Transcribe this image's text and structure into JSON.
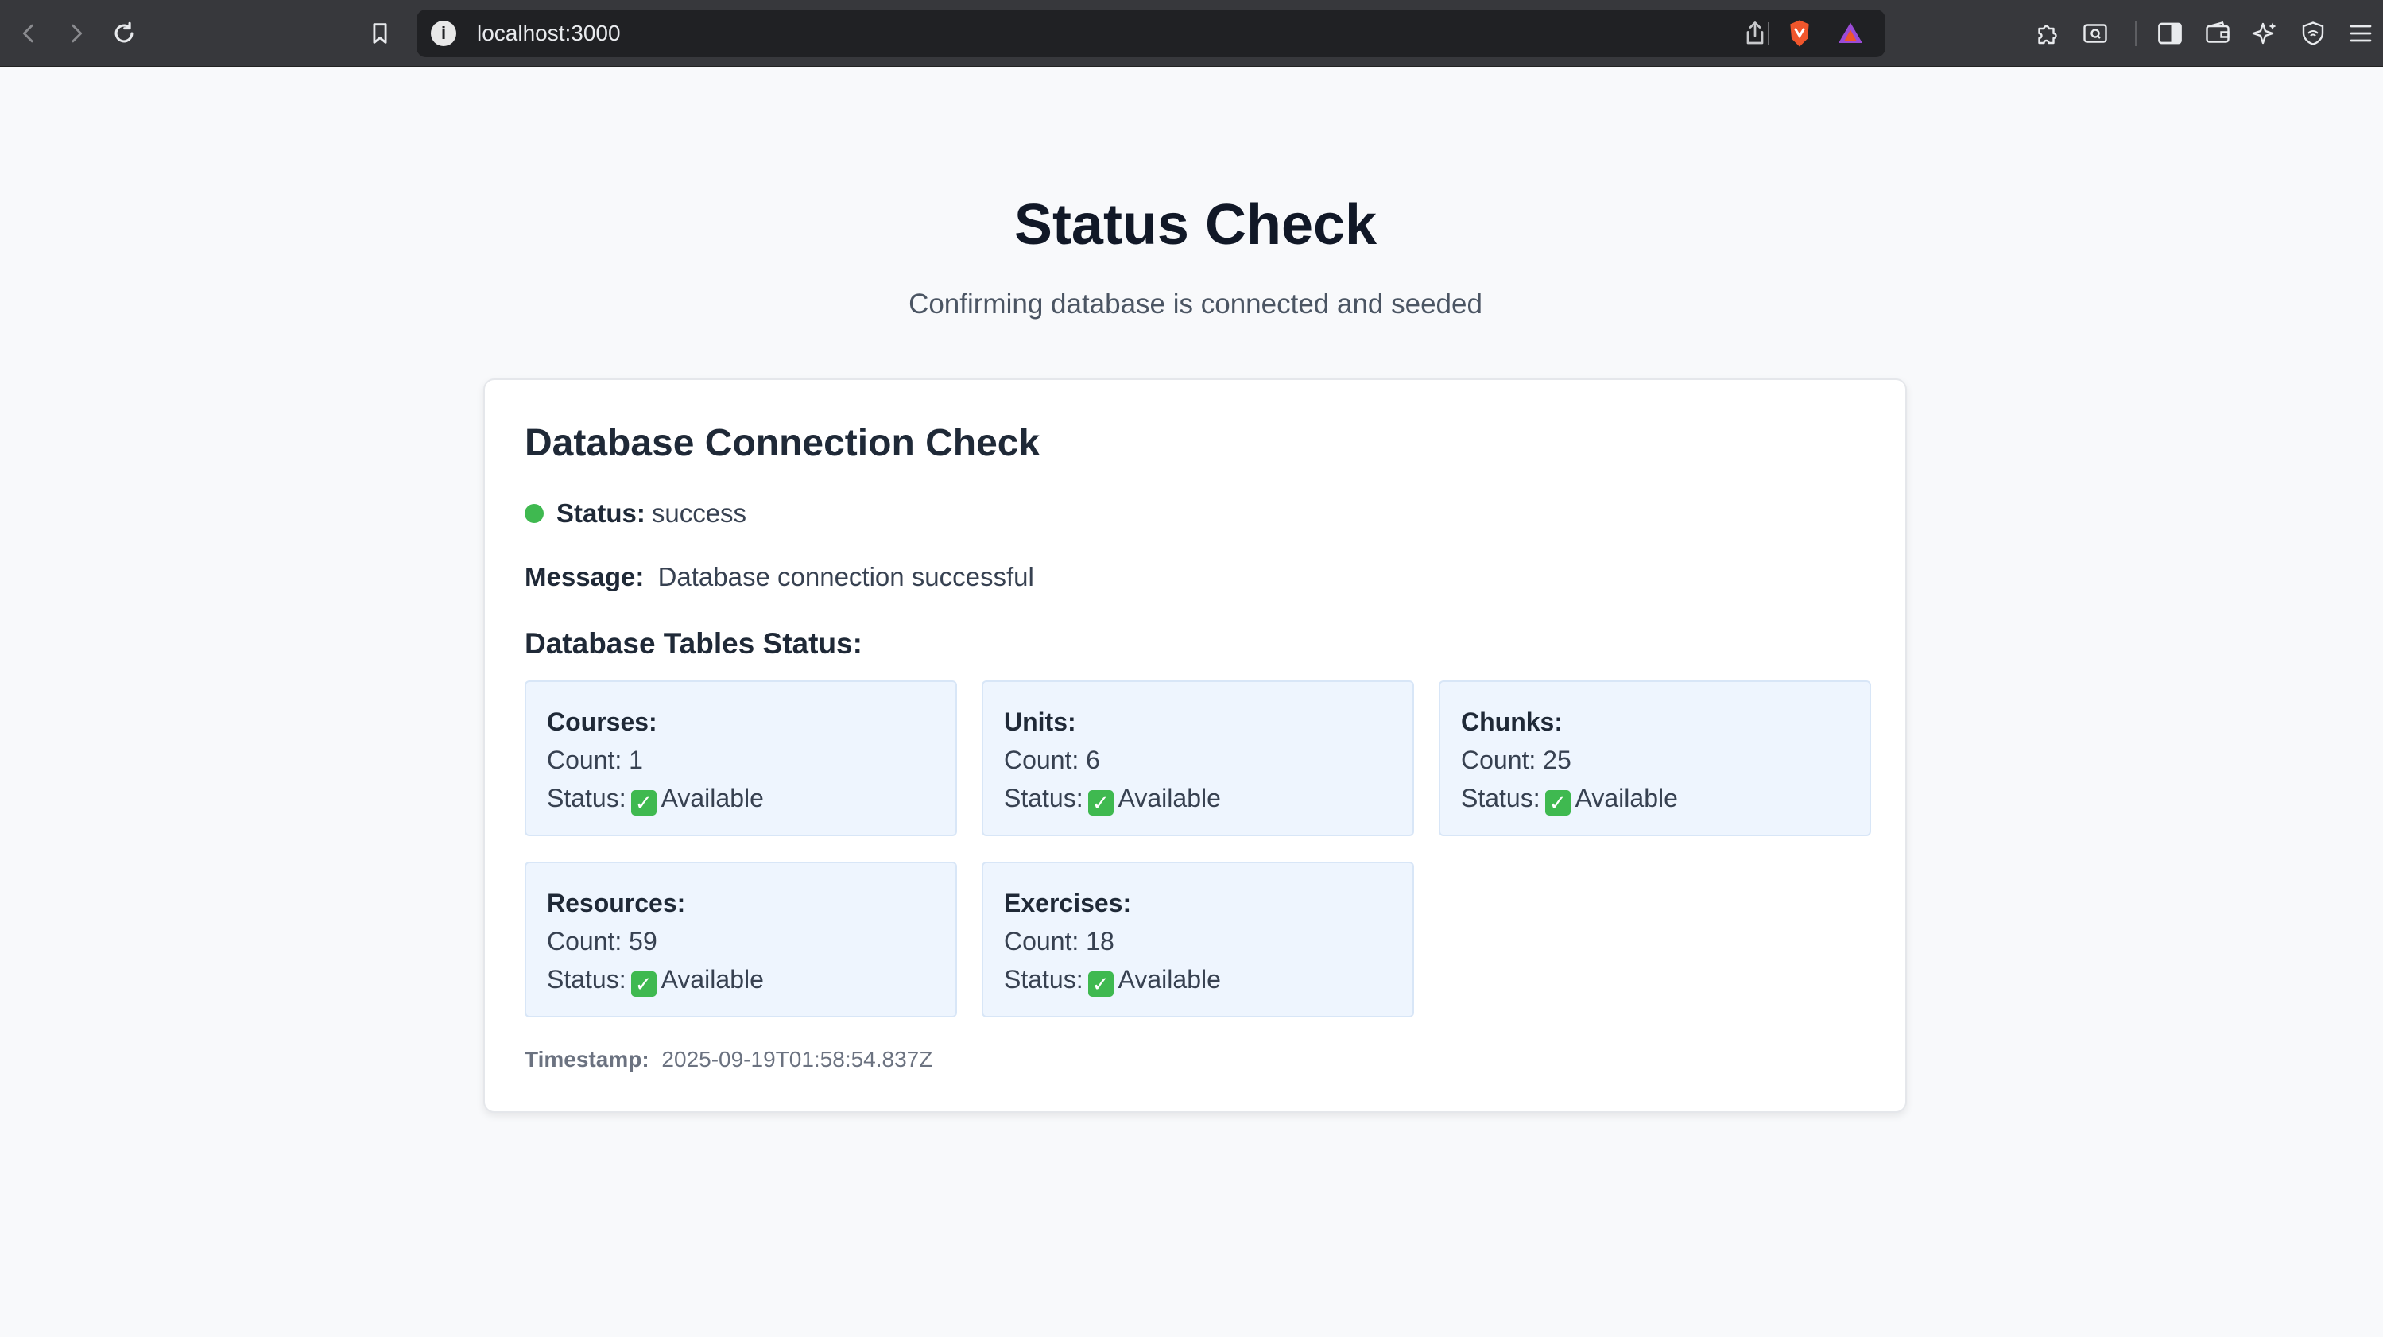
{
  "browser": {
    "url": "localhost:3000",
    "colors": {
      "chrome_bg": "#37383c",
      "address_bg": "#202124"
    }
  },
  "page": {
    "title": "Status Check",
    "subtitle": "Confirming database is connected and seeded"
  },
  "card": {
    "title": "Database Connection Check",
    "status_label": "Status:",
    "status_value": "success",
    "status_color": "#3fb950",
    "message_label": "Message:",
    "message_value": "Database connection successful",
    "tables_heading": "Database Tables Status:",
    "tables": [
      {
        "name": "Courses:",
        "count_label": "Count:",
        "count": "1",
        "status_label": "Status:",
        "status_value": "Available"
      },
      {
        "name": "Units:",
        "count_label": "Count:",
        "count": "6",
        "status_label": "Status:",
        "status_value": "Available"
      },
      {
        "name": "Chunks:",
        "count_label": "Count:",
        "count": "25",
        "status_label": "Status:",
        "status_value": "Available"
      },
      {
        "name": "Resources:",
        "count_label": "Count:",
        "count": "59",
        "status_label": "Status:",
        "status_value": "Available"
      },
      {
        "name": "Exercises:",
        "count_label": "Count:",
        "count": "18",
        "status_label": "Status:",
        "status_value": "Available"
      }
    ],
    "timestamp_label": "Timestamp:",
    "timestamp_value": "2025-09-19T01:58:54.837Z"
  }
}
